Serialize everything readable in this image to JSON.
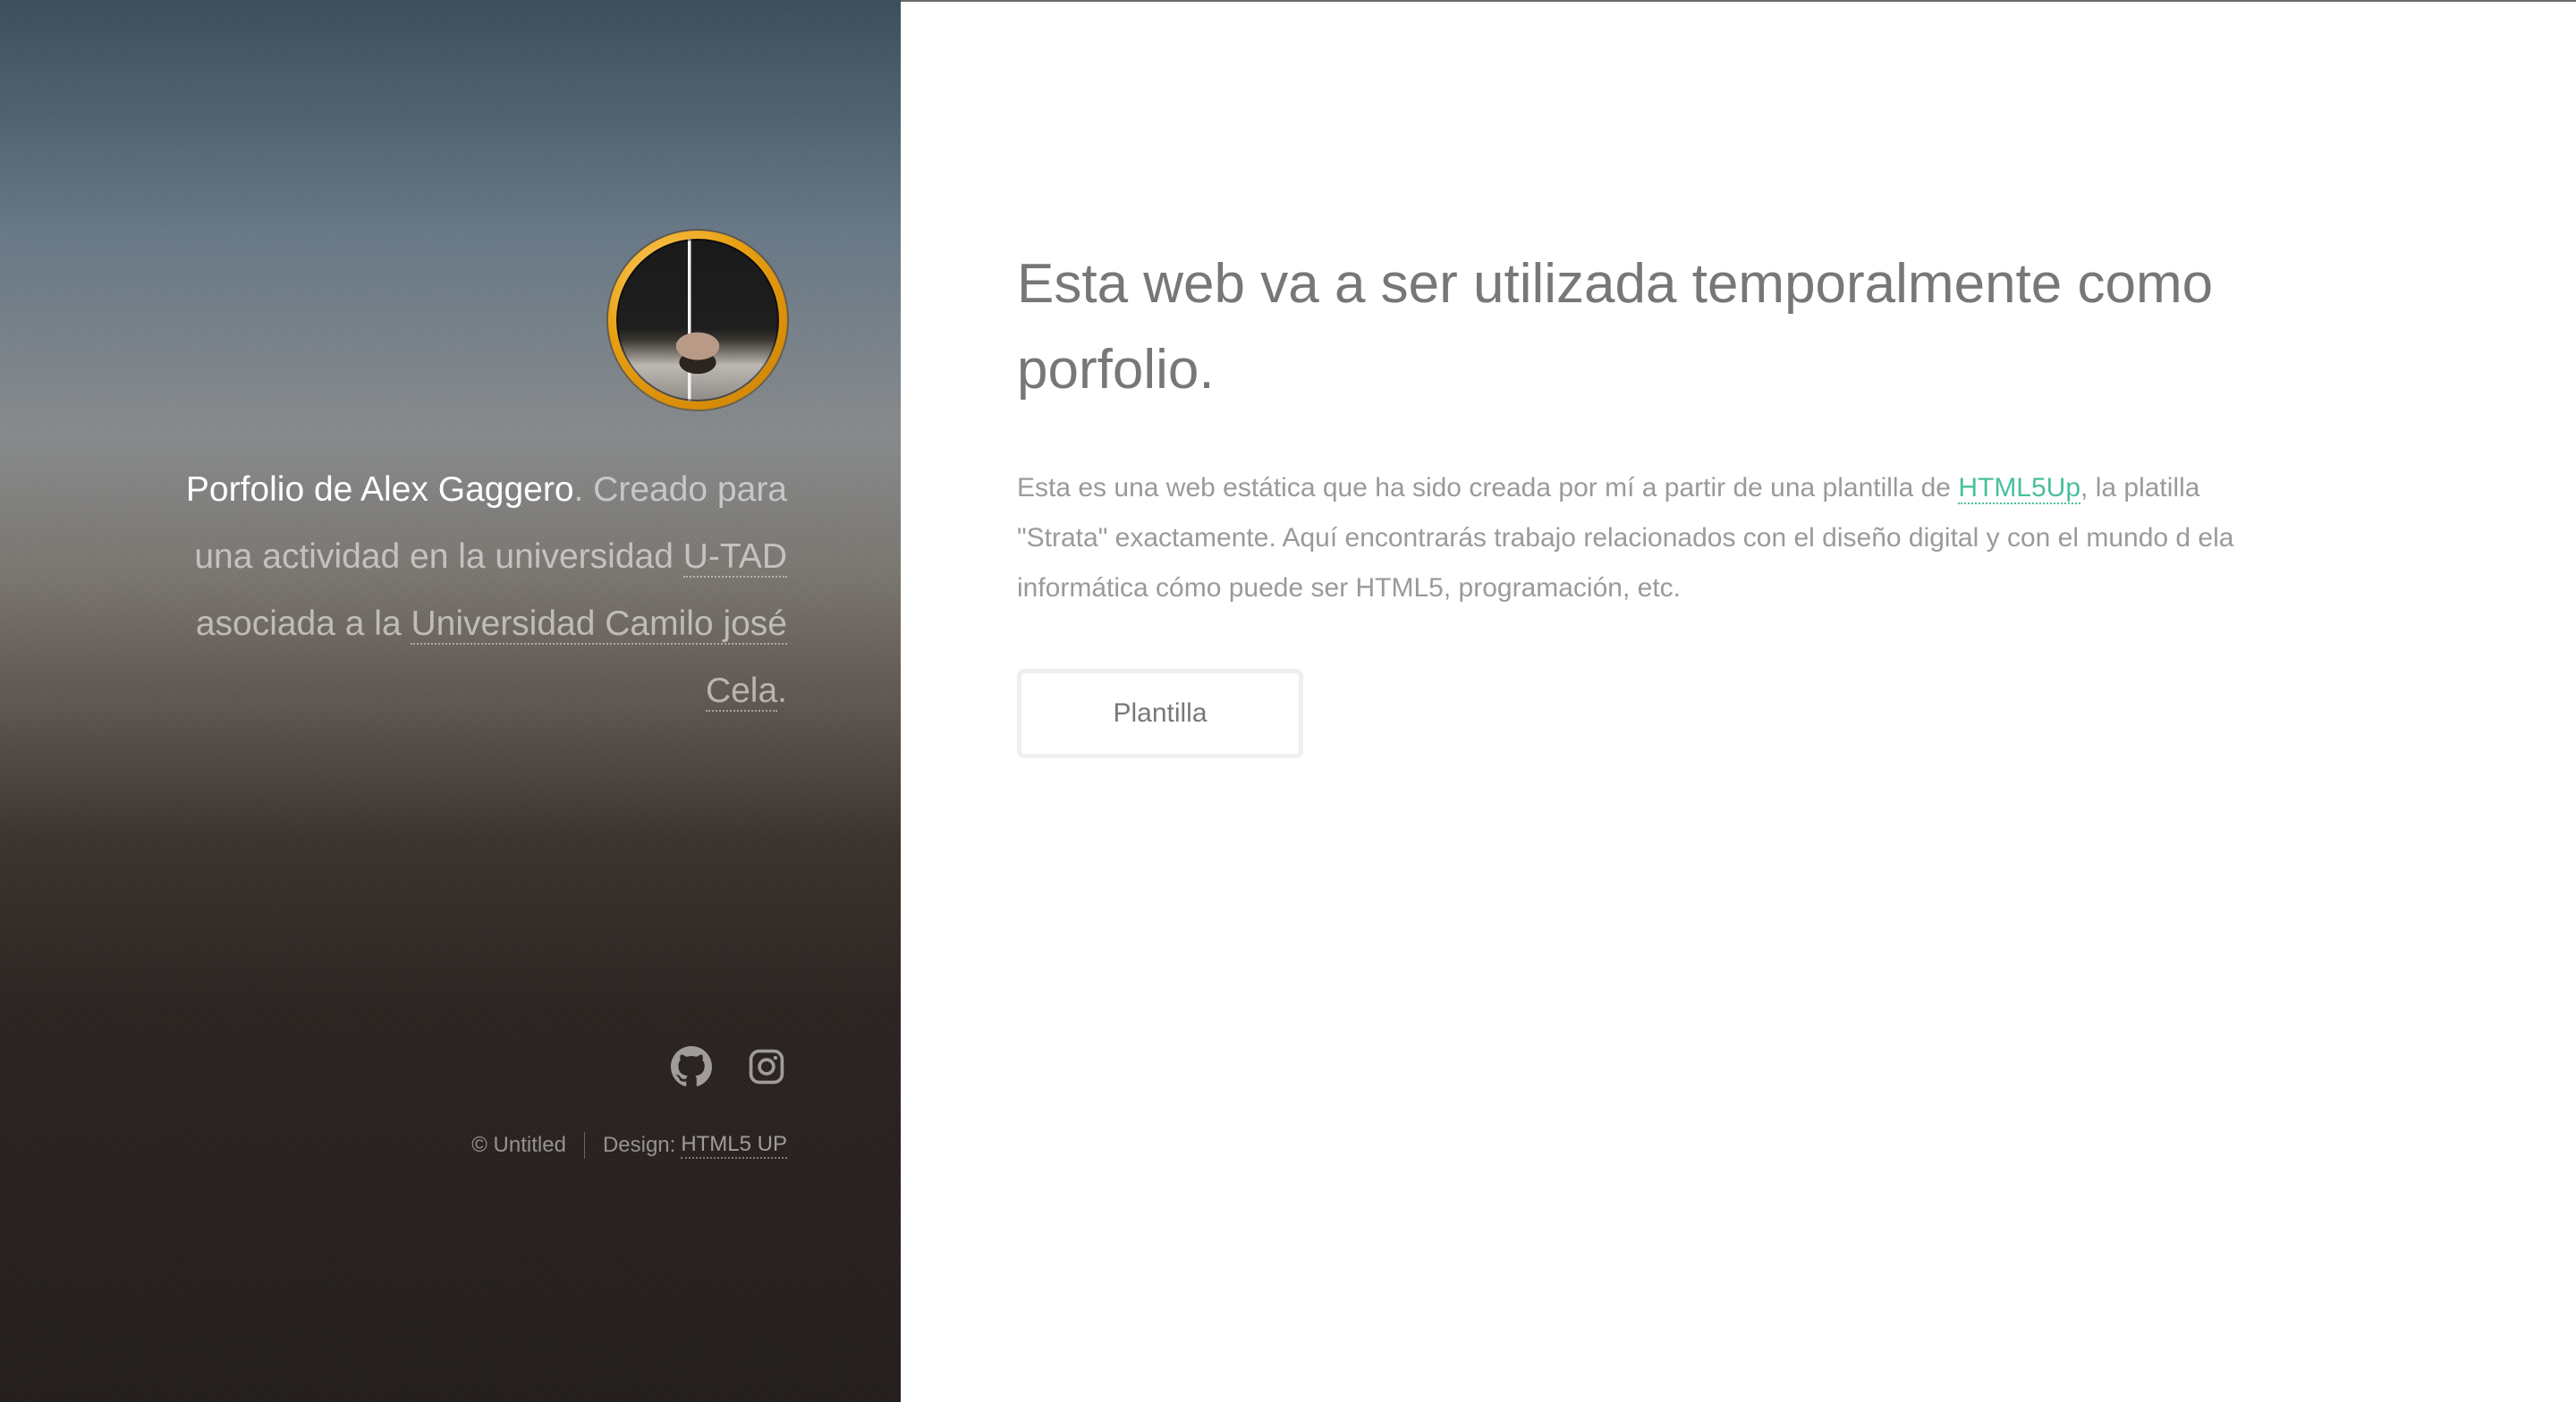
{
  "sidebar": {
    "intro": {
      "name": "Porfolio de Alex Gaggero",
      "text_after_name": ". Creado para una actividad en la universidad ",
      "link_utad": "U-TAD",
      "text_middle": " asociada a la ",
      "link_ucjc": "Universidad Camilo josé Cela",
      "text_end": "."
    },
    "social": [
      {
        "icon": "github-icon"
      },
      {
        "icon": "instagram-icon"
      }
    ],
    "footer": {
      "copyright": "© Untitled",
      "design_label": "Design:",
      "design_link": "HTML5 UP"
    }
  },
  "main": {
    "headline": "Esta web va a ser utilizada temporalmente como porfolio.",
    "description": {
      "before_link": "Esta es una web estática que ha sido creada por mí a partir de una plantilla de ",
      "link": "HTML5Up",
      "after_link": ", la platilla \"Strata\" exactamente. Aquí encontrarás trabajo relacionados con el diseño digital y con el mundo d ela informática cómo puede ser HTML5, programación, etc."
    },
    "button_label": "Plantilla"
  },
  "colors": {
    "accent": "#49bf9d",
    "avatar_ring": "#e9a012",
    "headline_text": "#777777",
    "body_text": "#9a9a9a"
  }
}
